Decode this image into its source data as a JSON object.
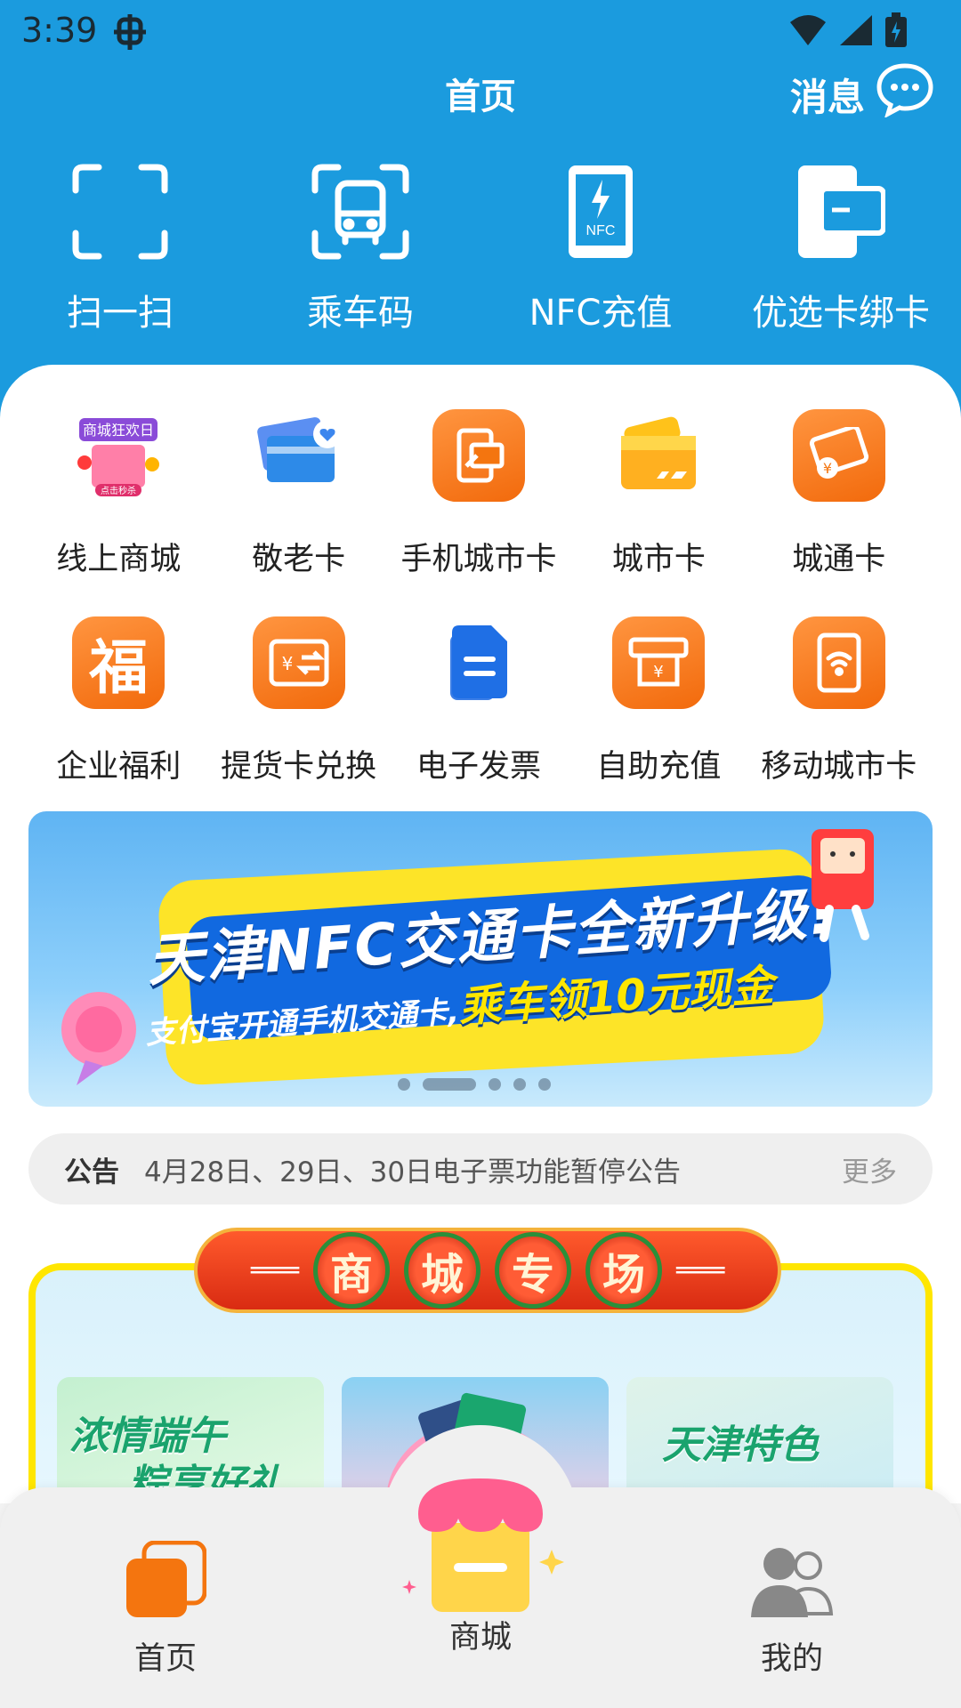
{
  "status": {
    "time": "3:39"
  },
  "header": {
    "title": "首页",
    "messages_label": "消息"
  },
  "quick_actions": [
    {
      "label": "扫一扫",
      "icon": "scan-icon"
    },
    {
      "label": "乘车码",
      "icon": "bus-code-icon"
    },
    {
      "label": "NFC充值",
      "icon": "nfc-phone-icon",
      "icon_text": "NFC"
    },
    {
      "label": "优选卡绑卡",
      "icon": "bind-card-icon"
    }
  ],
  "services": [
    {
      "label": "线上商城",
      "icon": "online-mall-icon",
      "badge": "商城狂欢日",
      "badge2": "点击秒杀"
    },
    {
      "label": "敬老卡",
      "icon": "senior-card-icon"
    },
    {
      "label": "手机城市卡",
      "icon": "mobile-city-card-icon"
    },
    {
      "label": "城市卡",
      "icon": "city-card-icon"
    },
    {
      "label": "城通卡",
      "icon": "chengtong-card-icon",
      "glyph": "¥"
    },
    {
      "label": "企业福利",
      "icon": "enterprise-welfare-icon",
      "glyph": "福"
    },
    {
      "label": "提货卡兑换",
      "icon": "voucher-exchange-icon",
      "glyph": "¥"
    },
    {
      "label": "电子发票",
      "icon": "e-invoice-icon"
    },
    {
      "label": "自助充值",
      "icon": "self-recharge-icon",
      "glyph": "¥"
    },
    {
      "label": "移动城市卡",
      "icon": "mobile-wireless-card-icon"
    }
  ],
  "banner": {
    "title": "天津NFC交通卡全新升级!",
    "subtitle": "支付宝开通手机交通卡,",
    "highlight": "乘车领10元现金",
    "active_page": 2,
    "page_count": 5
  },
  "notice": {
    "tag": "公告",
    "text": "4月28日、29日、30日电子票功能暂停公告",
    "more": "更多"
  },
  "mall_section": {
    "title_chars": [
      "商",
      "城",
      "专",
      "场"
    ],
    "cards": [
      {
        "line1": "浓情端午",
        "line2": "粽享好礼"
      },
      {
        "line1": "",
        "line2": ""
      },
      {
        "line1": "天津特色",
        "line2": ""
      }
    ]
  },
  "tabbar": {
    "home": "首页",
    "mall": "商城",
    "mine": "我的"
  },
  "colors": {
    "header_blue": "#1b9bde",
    "accent_orange": "#f4750f"
  }
}
